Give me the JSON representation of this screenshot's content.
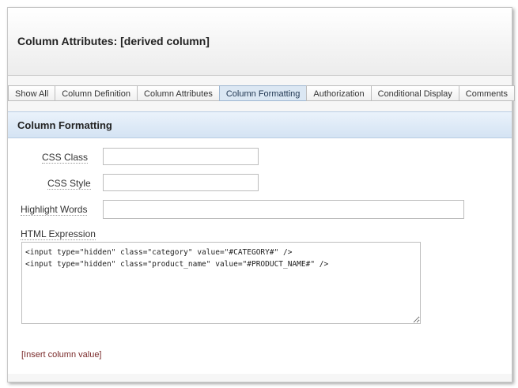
{
  "header": {
    "title": "Column Attributes: [derived column]"
  },
  "tabs": [
    {
      "label": "Show All"
    },
    {
      "label": "Column Definition"
    },
    {
      "label": "Column Attributes"
    },
    {
      "label": "Column Formatting",
      "active": true
    },
    {
      "label": "Authorization"
    },
    {
      "label": "Conditional Display"
    },
    {
      "label": "Comments"
    }
  ],
  "section": {
    "title": "Column Formatting"
  },
  "fields": {
    "css_class": {
      "label": "CSS Class",
      "value": ""
    },
    "css_style": {
      "label": "CSS Style",
      "value": ""
    },
    "highlight_words": {
      "label": "Highlight Words",
      "value": ""
    },
    "html_expression": {
      "label": "HTML Expression",
      "value": "<input type=\"hidden\" class=\"category\" value=\"#CATEGORY#\" />\n<input type=\"hidden\" class=\"product_name\" value=\"#PRODUCT_NAME#\" />"
    }
  },
  "insert_link": "[Insert column value]",
  "colors": {
    "active_tab_bg": "#dbe7f3",
    "section_bar": "#d4e3f3",
    "link": "#7a2a2a"
  }
}
